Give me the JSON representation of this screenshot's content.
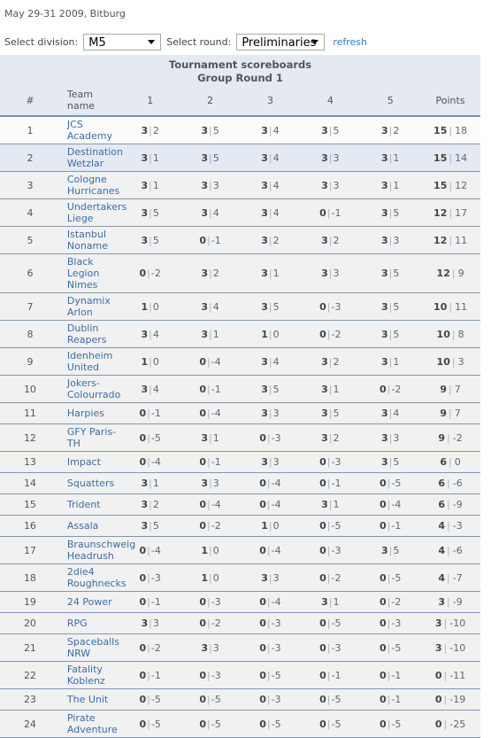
{
  "event": {
    "date_location": "May 29-31 2009, Bitburg"
  },
  "controls": {
    "division_label": "Select division:",
    "division_value": "M5",
    "round_label": "Select round:",
    "round_value": "Preliminaries",
    "refresh_label": "refresh"
  },
  "board": {
    "title_line1": "Tournament scoreboards",
    "title_line2": "Group Round 1",
    "columns": {
      "rank": "#",
      "team": "Team name",
      "g1": "1",
      "g2": "2",
      "g3": "3",
      "g4": "4",
      "g5": "5",
      "points": "Points"
    },
    "rows": [
      {
        "rank": "1",
        "team": "JCS Academy",
        "games": [
          [
            "3",
            "2"
          ],
          [
            "3",
            "5"
          ],
          [
            "3",
            "4"
          ],
          [
            "3",
            "5"
          ],
          [
            "3",
            "2"
          ]
        ],
        "points": "15",
        "diff": "18"
      },
      {
        "rank": "2",
        "team": "Destination Wetzlar",
        "games": [
          [
            "3",
            "1"
          ],
          [
            "3",
            "5"
          ],
          [
            "3",
            "4"
          ],
          [
            "3",
            "3"
          ],
          [
            "3",
            "1"
          ]
        ],
        "points": "15",
        "diff": "14"
      },
      {
        "rank": "3",
        "team": "Cologne Hurricanes",
        "games": [
          [
            "3",
            "1"
          ],
          [
            "3",
            "3"
          ],
          [
            "3",
            "4"
          ],
          [
            "3",
            "3"
          ],
          [
            "3",
            "1"
          ]
        ],
        "points": "15",
        "diff": "12"
      },
      {
        "rank": "4",
        "team": "Undertakers Liege",
        "games": [
          [
            "3",
            "5"
          ],
          [
            "3",
            "4"
          ],
          [
            "3",
            "4"
          ],
          [
            "0",
            "-1"
          ],
          [
            "3",
            "5"
          ]
        ],
        "points": "12",
        "diff": "17"
      },
      {
        "rank": "5",
        "team": "Istanbul Noname",
        "games": [
          [
            "3",
            "5"
          ],
          [
            "0",
            "-1"
          ],
          [
            "3",
            "2"
          ],
          [
            "3",
            "2"
          ],
          [
            "3",
            "3"
          ]
        ],
        "points": "12",
        "diff": "11"
      },
      {
        "rank": "6",
        "team": "Black Legion Nimes",
        "games": [
          [
            "0",
            "-2"
          ],
          [
            "3",
            "2"
          ],
          [
            "3",
            "1"
          ],
          [
            "3",
            "3"
          ],
          [
            "3",
            "5"
          ]
        ],
        "points": "12",
        "diff": "9"
      },
      {
        "rank": "7",
        "team": "Dynamix Arlon",
        "games": [
          [
            "1",
            "0"
          ],
          [
            "3",
            "4"
          ],
          [
            "3",
            "5"
          ],
          [
            "0",
            "-3"
          ],
          [
            "3",
            "5"
          ]
        ],
        "points": "10",
        "diff": "11"
      },
      {
        "rank": "8",
        "team": "Dublin Reapers",
        "games": [
          [
            "3",
            "4"
          ],
          [
            "3",
            "1"
          ],
          [
            "1",
            "0"
          ],
          [
            "0",
            "-2"
          ],
          [
            "3",
            "5"
          ]
        ],
        "points": "10",
        "diff": "8"
      },
      {
        "rank": "9",
        "team": "Idenheim United",
        "games": [
          [
            "1",
            "0"
          ],
          [
            "0",
            "-4"
          ],
          [
            "3",
            "4"
          ],
          [
            "3",
            "2"
          ],
          [
            "3",
            "1"
          ]
        ],
        "points": "10",
        "diff": "3"
      },
      {
        "rank": "10",
        "team": "Jokers-Colourrado",
        "games": [
          [
            "3",
            "4"
          ],
          [
            "0",
            "-1"
          ],
          [
            "3",
            "5"
          ],
          [
            "3",
            "1"
          ],
          [
            "0",
            "-2"
          ]
        ],
        "points": "9",
        "diff": "7"
      },
      {
        "rank": "11",
        "team": "Harpies",
        "games": [
          [
            "0",
            "-1"
          ],
          [
            "0",
            "-4"
          ],
          [
            "3",
            "3"
          ],
          [
            "3",
            "5"
          ],
          [
            "3",
            "4"
          ]
        ],
        "points": "9",
        "diff": "7"
      },
      {
        "rank": "12",
        "team": "GFY Paris-TH",
        "games": [
          [
            "0",
            "-5"
          ],
          [
            "3",
            "1"
          ],
          [
            "0",
            "-3"
          ],
          [
            "3",
            "2"
          ],
          [
            "3",
            "3"
          ]
        ],
        "points": "9",
        "diff": "-2"
      },
      {
        "rank": "13",
        "team": "Impact",
        "games": [
          [
            "0",
            "-4"
          ],
          [
            "0",
            "-1"
          ],
          [
            "3",
            "3"
          ],
          [
            "0",
            "-3"
          ],
          [
            "3",
            "5"
          ]
        ],
        "points": "6",
        "diff": "0"
      },
      {
        "rank": "14",
        "team": "Squatters",
        "games": [
          [
            "3",
            "1"
          ],
          [
            "3",
            "3"
          ],
          [
            "0",
            "-4"
          ],
          [
            "0",
            "-1"
          ],
          [
            "0",
            "-5"
          ]
        ],
        "points": "6",
        "diff": "-6"
      },
      {
        "rank": "15",
        "team": "Trident",
        "games": [
          [
            "3",
            "2"
          ],
          [
            "0",
            "-4"
          ],
          [
            "0",
            "-4"
          ],
          [
            "3",
            "1"
          ],
          [
            "0",
            "-4"
          ]
        ],
        "points": "6",
        "diff": "-9"
      },
      {
        "rank": "16",
        "team": "Assala",
        "games": [
          [
            "3",
            "5"
          ],
          [
            "0",
            "-2"
          ],
          [
            "1",
            "0"
          ],
          [
            "0",
            "-5"
          ],
          [
            "0",
            "-1"
          ]
        ],
        "points": "4",
        "diff": "-3"
      },
      {
        "rank": "17",
        "team": "Braunschweig Headrush",
        "games": [
          [
            "0",
            "-4"
          ],
          [
            "1",
            "0"
          ],
          [
            "0",
            "-4"
          ],
          [
            "0",
            "-3"
          ],
          [
            "3",
            "5"
          ]
        ],
        "points": "4",
        "diff": "-6"
      },
      {
        "rank": "18",
        "team": "2die4 Roughnecks",
        "games": [
          [
            "0",
            "-3"
          ],
          [
            "1",
            "0"
          ],
          [
            "3",
            "3"
          ],
          [
            "0",
            "-2"
          ],
          [
            "0",
            "-5"
          ]
        ],
        "points": "4",
        "diff": "-7"
      },
      {
        "rank": "19",
        "team": "24 Power",
        "games": [
          [
            "0",
            "-1"
          ],
          [
            "0",
            "-3"
          ],
          [
            "0",
            "-4"
          ],
          [
            "3",
            "1"
          ],
          [
            "0",
            "-2"
          ]
        ],
        "points": "3",
        "diff": "-9"
      },
      {
        "rank": "20",
        "team": "RPG",
        "games": [
          [
            "3",
            "3"
          ],
          [
            "0",
            "-2"
          ],
          [
            "0",
            "-3"
          ],
          [
            "0",
            "-5"
          ],
          [
            "0",
            "-3"
          ]
        ],
        "points": "3",
        "diff": "-10"
      },
      {
        "rank": "21",
        "team": "Spaceballs NRW",
        "games": [
          [
            "0",
            "-2"
          ],
          [
            "3",
            "3"
          ],
          [
            "0",
            "-3"
          ],
          [
            "0",
            "-3"
          ],
          [
            "0",
            "-5"
          ]
        ],
        "points": "3",
        "diff": "-10"
      },
      {
        "rank": "22",
        "team": "Fatality Koblenz",
        "games": [
          [
            "0",
            "-1"
          ],
          [
            "0",
            "-3"
          ],
          [
            "0",
            "-5"
          ],
          [
            "0",
            "-1"
          ],
          [
            "0",
            "-1"
          ]
        ],
        "points": "0",
        "diff": "-11"
      },
      {
        "rank": "23",
        "team": "The Unit",
        "games": [
          [
            "0",
            "-5"
          ],
          [
            "0",
            "-5"
          ],
          [
            "0",
            "-3"
          ],
          [
            "0",
            "-5"
          ],
          [
            "0",
            "-1"
          ]
        ],
        "points": "0",
        "diff": "-19"
      },
      {
        "rank": "24",
        "team": "Pirate Adventure",
        "games": [
          [
            "0",
            "-5"
          ],
          [
            "0",
            "-5"
          ],
          [
            "0",
            "-5"
          ],
          [
            "0",
            "-5"
          ],
          [
            "0",
            "-5"
          ]
        ],
        "points": "0",
        "diff": "-25"
      }
    ]
  },
  "colors": {
    "header_bg": "#e4e9f2",
    "link": "#3a6ea5",
    "row_bg": "#f1f1f1",
    "border": "#8098b0"
  }
}
